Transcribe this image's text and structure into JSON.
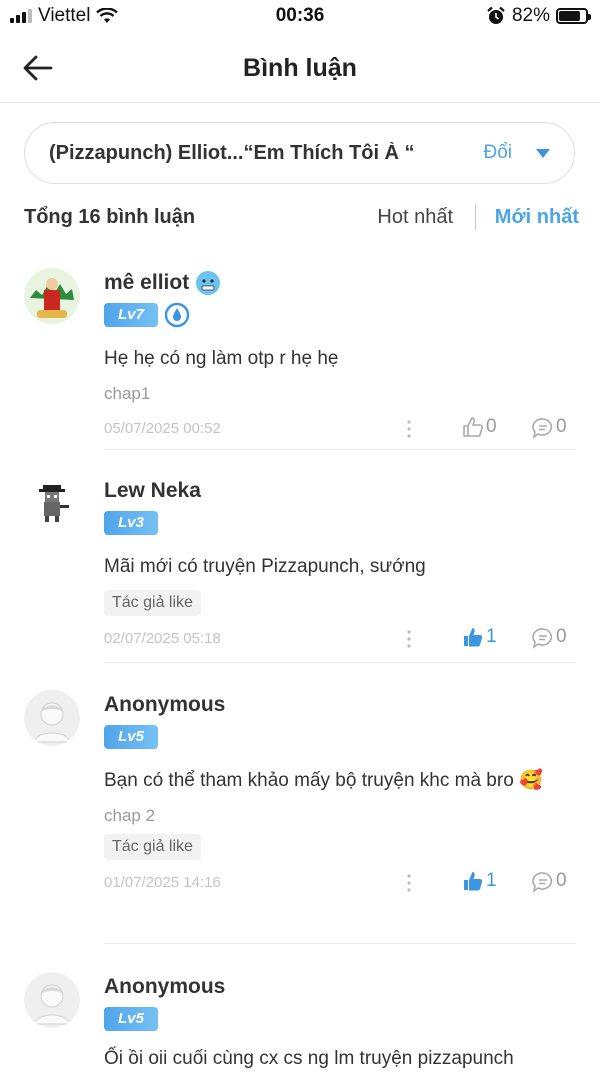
{
  "status_bar": {
    "carrier": "Viettel",
    "time": "00:36",
    "battery": "82%",
    "battery_level": 0.82,
    "icons": [
      "signal-icon",
      "wifi-icon",
      "alarm-icon",
      "battery-icon"
    ]
  },
  "header": {
    "title": "Bình luận",
    "back_icon": "arrow-left-icon"
  },
  "chapter_selector": {
    "title": "(Pizzapunch) Elliot...“Em Thích Tôi À “",
    "change_label": "Đổi"
  },
  "sort": {
    "total": "Tổng 16 bình luận",
    "hot": "Hot nhất",
    "newest": "Mới nhất",
    "active": "newest"
  },
  "colors": {
    "accent": "#4aa6e8",
    "badge_start": "#4fa5ea",
    "badge_end": "#76c1f4",
    "muted": "#9a9a9a"
  },
  "comments": [
    {
      "name": "mê elliot",
      "level": "Lv7",
      "text": "Hẹ hẹ có ng làm otp r hẹ hẹ",
      "chap": "chap1",
      "author_like": "",
      "date": "05/07/2025 00:52",
      "likes": "0",
      "replies": "0",
      "liked": false
    },
    {
      "name": "Lew Neka",
      "level": "Lv3",
      "text": "Mãi mới có truyện Pizzapunch, sướng",
      "chap": "",
      "author_like": "Tác giả like",
      "date": "02/07/2025 05:18",
      "likes": "1",
      "replies": "0",
      "liked": true
    },
    {
      "name": "Anonymous",
      "level": "Lv5",
      "text": "Bạn có thể tham khảo mấy bộ truyện khc mà bro 🥰",
      "chap": "chap 2",
      "author_like": "Tác giả like",
      "date": "01/07/2025 14:16",
      "likes": "1",
      "replies": "0",
      "liked": true
    },
    {
      "name": "Anonymous",
      "level": "Lv5",
      "text": "Ối ồi oii cuối cùng cx cs ng lm truyện pizzapunch",
      "chap": "",
      "author_like": "",
      "date": "",
      "likes": "",
      "replies": "",
      "liked": false
    }
  ]
}
